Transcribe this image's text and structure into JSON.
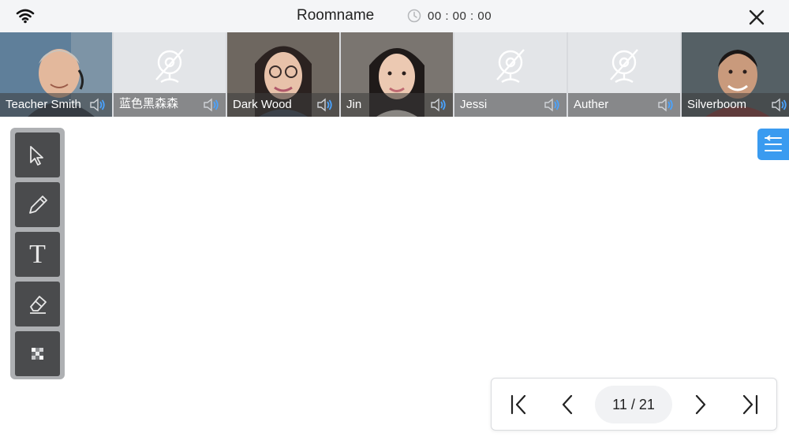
{
  "header": {
    "room_name": "Roomname",
    "timer": "00 : 00 : 00"
  },
  "participants": [
    {
      "name": "Teacher Smith",
      "video": true
    },
    {
      "name": "蓝色黑森森",
      "video": false
    },
    {
      "name": "Dark Wood",
      "video": true
    },
    {
      "name": "Jin",
      "video": true
    },
    {
      "name": "Jessi",
      "video": false
    },
    {
      "name": "Auther",
      "video": false
    },
    {
      "name": "Silverboom",
      "video": true
    }
  ],
  "tools": {
    "text_glyph": "T"
  },
  "pager": {
    "page": "11 / 21"
  },
  "colors": {
    "accent": "#3a9bf0",
    "speaker": "#4aa3ff",
    "toolbar_bg": "#aeb0b3",
    "tool_bg": "#4a4b4d"
  },
  "icons": {
    "wifi": "wifi-icon",
    "clock": "clock-icon",
    "close": "close-icon",
    "no_camera": "camera-off-icon",
    "speaker": "speaker-icon",
    "select": "cursor-arrow-icon",
    "pen": "pencil-icon",
    "text": "text-tool-icon",
    "eraser": "eraser-icon",
    "mosaic": "mosaic-icon",
    "menu": "collapse-menu-icon",
    "first": "first-page-icon",
    "prev": "prev-page-icon",
    "next": "next-page-icon",
    "last": "last-page-icon"
  }
}
